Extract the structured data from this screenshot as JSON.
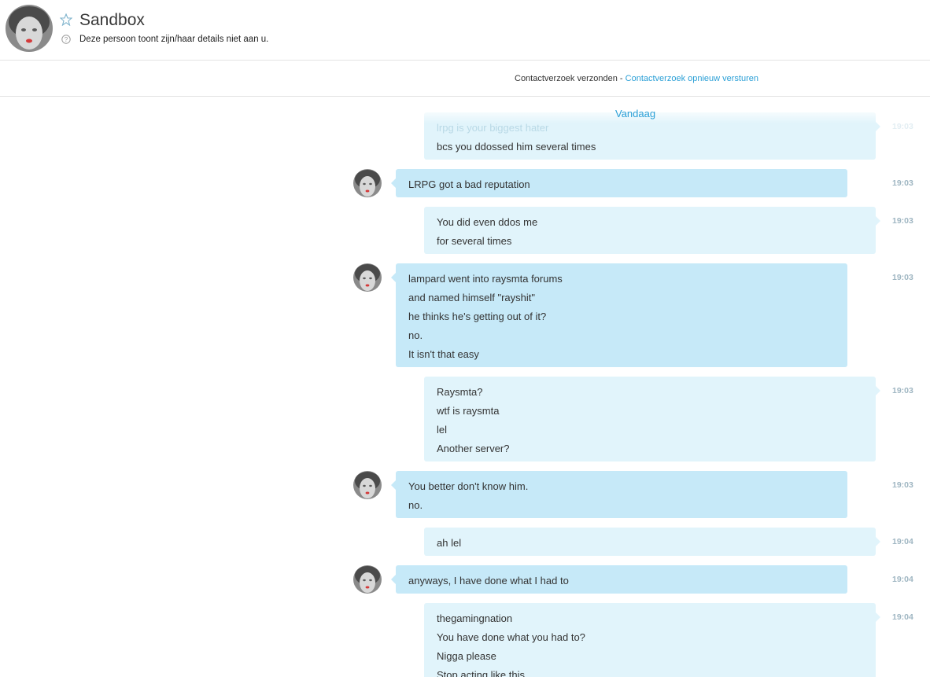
{
  "header": {
    "contact_name": "Sandbox",
    "privacy_note": "Deze persoon toont zijn/haar details niet aan u.",
    "star_icon": "star-outline-icon",
    "info_icon": "question-circle-icon"
  },
  "request": {
    "sent_text": "Contactverzoek verzonden - ",
    "resend_link": "Contactverzoek opnieuw versturen"
  },
  "conversation": {
    "date_separator": "Vandaag",
    "messages": [
      {
        "sender": "self",
        "lines": [
          "lrpg is your biggest hater",
          "bcs you ddossed him several times"
        ],
        "time": "19:03"
      },
      {
        "sender": "other",
        "lines": [
          "LRPG got a bad reputation"
        ],
        "time": "19:03"
      },
      {
        "sender": "self",
        "lines": [
          "You did even ddos me",
          "for several times"
        ],
        "time": "19:03"
      },
      {
        "sender": "other",
        "lines": [
          "lampard went into raysmta forums",
          "and named himself \"rayshit\"",
          "he thinks he's getting out of it?",
          "no.",
          "It isn't that easy"
        ],
        "time": "19:03"
      },
      {
        "sender": "self",
        "lines": [
          "Raysmta?",
          "wtf is raysmta",
          "lel",
          "Another server?"
        ],
        "time": "19:03"
      },
      {
        "sender": "other",
        "lines": [
          "You better don't know him.",
          "no."
        ],
        "time": "19:03"
      },
      {
        "sender": "self",
        "lines": [
          "ah lel"
        ],
        "time": "19:04"
      },
      {
        "sender": "other",
        "lines": [
          "anyways, I have done what I had to"
        ],
        "time": "19:04"
      },
      {
        "sender": "self",
        "lines": [
          "thegamingnation",
          "You have done what you had to?",
          "Nigga please",
          "Stop acting like this"
        ],
        "time": "19:04"
      }
    ]
  },
  "colors": {
    "accent": "#2a9fd6",
    "bubble_other": "#c6e9f8",
    "bubble_self": "#e1f4fb",
    "timestamp": "#9fb6c2"
  }
}
